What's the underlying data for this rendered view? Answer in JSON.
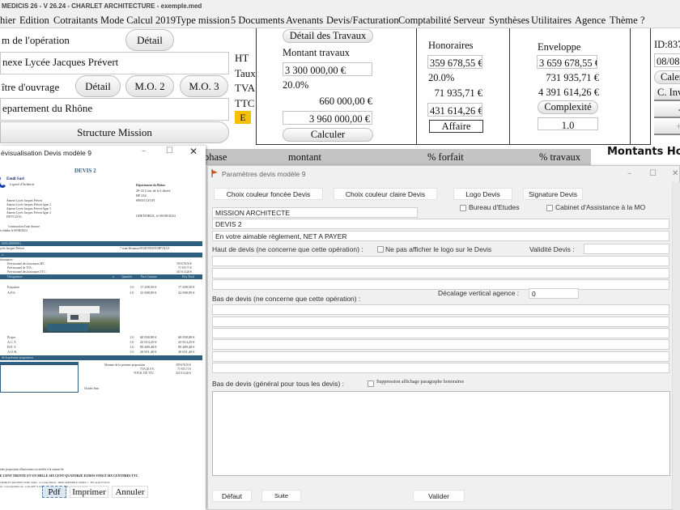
{
  "app": {
    "title": "MEDICIS 26  - V 26.24 - CHARLET ARCHITECTURE - exemple.med"
  },
  "menu": [
    "hier",
    "Edition",
    "Cotraitants",
    "Mode Calcul 2019",
    "Type mission",
    "5 Documents",
    "Avenants",
    "Devis/Facturation",
    "Comptabilité",
    "Serveur",
    "Synthèses",
    "Utilitaires",
    "Agence",
    "Thème",
    "?"
  ],
  "operation": {
    "name_label": "m de l'opération",
    "detail_button": "Détail",
    "name_value": "nexe Lycée Jacques Prévert",
    "owner_label": "ître d'ouvrage",
    "owner_detail_button": "Détail",
    "mo2_button": "M.O. 2",
    "mo3_button": "M.O. 3",
    "owner_value": "epartement du Rhône",
    "structure_button": "Structure Mission"
  },
  "value_labels": {
    "ht": "HT",
    "taux": "Taux",
    "tva": "TVA",
    "ttc": "TTC",
    "badge": "E"
  },
  "travaux": {
    "detail_button": "Détail des Travaux",
    "label": "Montant travaux",
    "ht": "3 300 000,00 €",
    "taux": "20.0%",
    "tva": "660 000,00 €",
    "ttc": "3 960 000,00 €",
    "calculer_button": "Calculer"
  },
  "honoraires": {
    "label": "Honoraires",
    "ht": "359 678,55 €",
    "taux": "20.0%",
    "tva": "71 935,71 €",
    "ttc": "431 614,26 €",
    "affaire_button": "Affaire"
  },
  "enveloppe": {
    "label": "Enveloppe",
    "ht": "3 659 678,55 €",
    "tva": "731 935,71 €",
    "ttc": "4 391 614,26 €",
    "complexite_button": "Complexité",
    "complexite_value": "1.0"
  },
  "idpanel": {
    "id": "ID:837",
    "date": "08/08",
    "calendar_button": "Caler",
    "c_inv_button": "C. Inv",
    "btn3": "-",
    "btn4": "+"
  },
  "grid": {
    "columns": [
      "phase",
      "montant",
      "% forfait",
      "% travaux"
    ],
    "side_title": "Montants Hono"
  },
  "preview": {
    "title": "évisualisation Devis modèle 9",
    "doc_title": "DEVIS 2",
    "company": "Emdi Sarl",
    "company_sub": "Logiciel d'Architecte",
    "address_lines": [
      "Annexe Lycée Jacques Prévert",
      "Annexe Lycée Jacques Prévert ligne 2",
      "Annexe Lycée Jacques Prévert ligne 3",
      "Annexe Lycée Jacques Prévert ligne 4",
      "DP/VC25-01"
    ],
    "construction": "Construction d'une Annexe",
    "date_line": "is établie le 08/08/2024",
    "recipient": [
      "Département du Rhône",
      "29-31 Cour de la Liberté",
      "BP 234",
      "69003 LYON"
    ],
    "place_date": "GRENOBLE, le 08/08/2024",
    "band1": "0202 2000000 )",
    "client_line": "ycée Jacques Prévert",
    "client_address": "7 route Beaunan 69340 FRANCHEVILLE",
    "band2": "s :",
    "prov_label": "isionnaires :",
    "prov": [
      {
        "label": "Prévisionnel des honoraires HT :",
        "value": "359 678,55 €"
      },
      {
        "label": "Prévisionnel de TVA :",
        "value": "71 935,71 €"
      },
      {
        "label": "Prévisionnel des honoraires TTC :",
        "value": "431 614,26 €"
      }
    ],
    "table_headers": [
      "Désignation",
      "u",
      "Quantité",
      "Prix Unitaire",
      "Prix Total"
    ],
    "rows": [
      {
        "name": "Esquisse",
        "qty": "1.0",
        "unit": "17 208,50 €",
        "total": "17 208,50 €"
      },
      {
        "name": "A.P.S.",
        "qty": "1.0",
        "unit": "32 698,85 €",
        "total": "32 698,85 €"
      },
      {
        "name": "Projet",
        "qty": "1.0",
        "unit": "68 838,80 €",
        "total": "68 838,80 €"
      },
      {
        "name": "A.C.T.",
        "qty": "1.0",
        "unit": "25 814,25 €",
        "total": "25 814,25 €"
      },
      {
        "name": "D.E.T.",
        "qty": "1.0",
        "unit": "89 489,40 €",
        "total": "89 489,40 €"
      },
      {
        "name": "A.O.R.",
        "qty": "1.0",
        "unit": "20 651,40 €",
        "total": "20 651,40 €"
      }
    ],
    "band3": "de la présente proposition",
    "totals": [
      {
        "label": "Montant de la présente proposition",
        "value": "359 678,55 €"
      },
      {
        "label": "TVA 20.0 %",
        "value": "71 935,71 €"
      },
      {
        "label": "TOTAL DÛ TTC",
        "value": "431 614,26 €"
      }
    ],
    "signature": "Charlet Jean",
    "amount_intro": "ente proposition d'honoraires est arrêtée à la somme de",
    "amount_words": "E CENT TRENTE ET UN MILLE SIX CENT QUATORZE EUROS VINGT SIX CENTIMES TTC",
    "footer1": "CHARLET ARCHITECTURE SARL - 21 avenue Benoit - 38000 GRENOBLE CEDEX 1 - TEL 04 00 07 00 02",
    "footer2": "ail : contact@emdi.com - Code APE 7111Z - Capital 424 476 - SIRET 476 000 000 00042",
    "pdf_button": "Pdf",
    "print_button": "Imprimer",
    "cancel_button": "Annuler"
  },
  "params": {
    "title": "Paramètres devis modèle 9",
    "btn_dark_color": "Choix couleur foncée Devis",
    "btn_light_color": "Choix couleur claire Devis",
    "btn_logo": "Logo Devis",
    "btn_signature": "Signature Devis",
    "mission_field": "MISSION ARCHITECTE",
    "chk_bureau": "Bureau d'Etudes",
    "chk_cabinet": "Cabinet d'Assistance à la MO",
    "devis_field": "DEVIS 2",
    "reglement_field": "En votre aimable règlement, NET A PAYER",
    "haut_label": "Haut de devis (ne concerne que cette opération) :",
    "chk_no_logo": "Ne pas afficher le logo sur le Devis",
    "validite_label": "Validité Devis :",
    "validite_value": "",
    "decalage_label": "Décalage vertical agence :",
    "decalage_value": "0",
    "bas_label": "Bas de devis  (ne concerne que cette opération) :",
    "bas_general_label": "Bas de devis  (général pour tous les devis) :",
    "chk_suppression": "Suppression affichage paragraphe honoraires",
    "btn_defaut": "Défaut",
    "btn_suite": "Suite",
    "btn_valider": "Valider"
  }
}
